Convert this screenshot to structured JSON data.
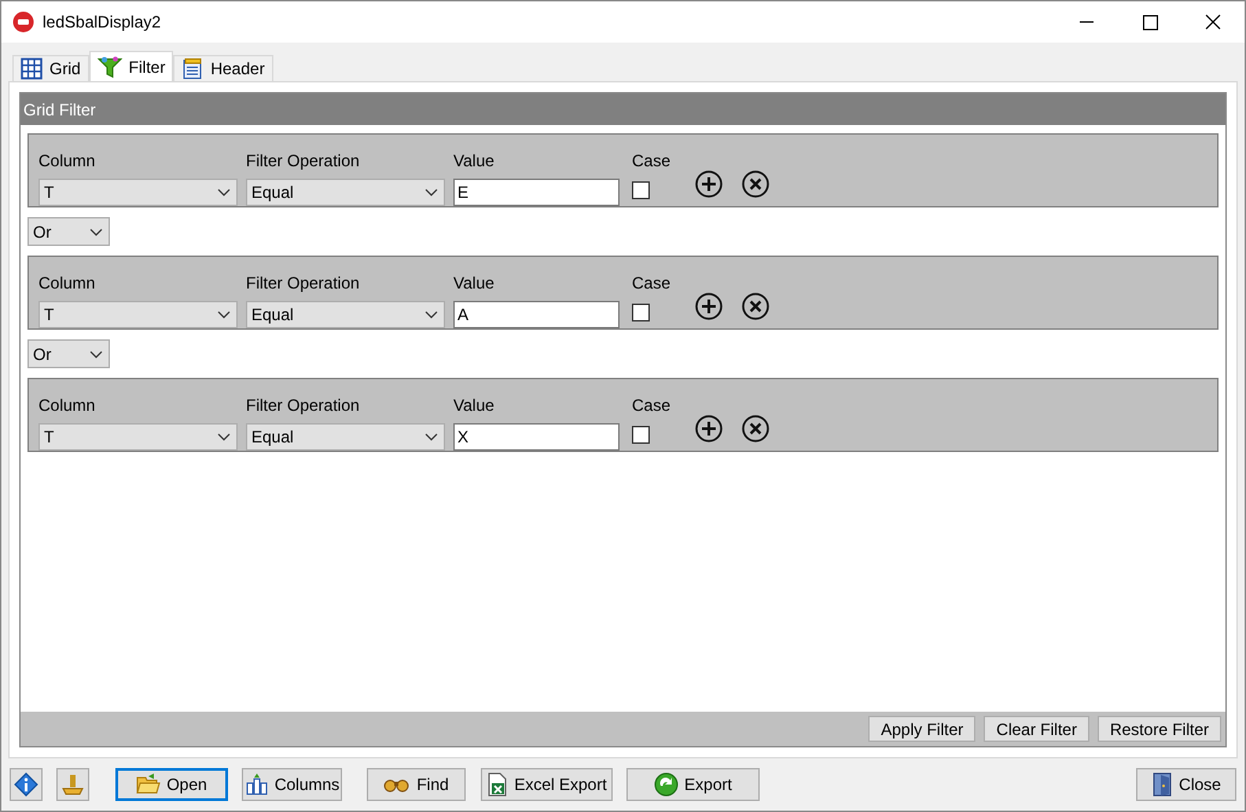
{
  "window": {
    "title": "ledSbalDisplay2"
  },
  "tabs": [
    {
      "label": "Grid",
      "kind": "grid",
      "selected": false
    },
    {
      "label": "Filter",
      "kind": "filter",
      "selected": true
    },
    {
      "label": "Header",
      "kind": "header",
      "selected": false
    }
  ],
  "panel": {
    "title": "Grid Filter"
  },
  "filters": [
    {
      "column_label": "Column",
      "column": "T",
      "operation_label": "Filter Operation",
      "operation": "Equal",
      "value_label": "Value",
      "value": "E",
      "case_label": "Case",
      "checked": false
    },
    {
      "joiner": "Or",
      "column_label": "Column",
      "column": "T",
      "operation_label": "Filter Operation",
      "operation": "Equal",
      "value_label": "Value",
      "value": "A",
      "case_label": "Case",
      "checked": false
    },
    {
      "joiner": "Or",
      "column_label": "Column",
      "column": "T",
      "operation_label": "Filter Operation",
      "operation": "Equal",
      "value_label": "Value",
      "value": "X",
      "case_label": "Case",
      "checked": false
    }
  ],
  "filter_buttons": [
    "Apply Filter",
    "Clear Filter",
    "Restore Filter"
  ],
  "footer_buttons": [
    {
      "kind": "info"
    },
    {
      "kind": "tool"
    },
    {
      "kind": "open",
      "label": "Open",
      "focused": true
    },
    {
      "kind": "columns",
      "label": "Columns",
      "focused": false
    },
    {
      "kind": "find",
      "label": "Find",
      "focused": false
    },
    {
      "kind": "excel",
      "label": "Excel Export",
      "focused": false
    },
    {
      "kind": "export",
      "label": "Export",
      "focused": false
    },
    {
      "kind": "close",
      "label": "Close",
      "focused": false
    }
  ]
}
